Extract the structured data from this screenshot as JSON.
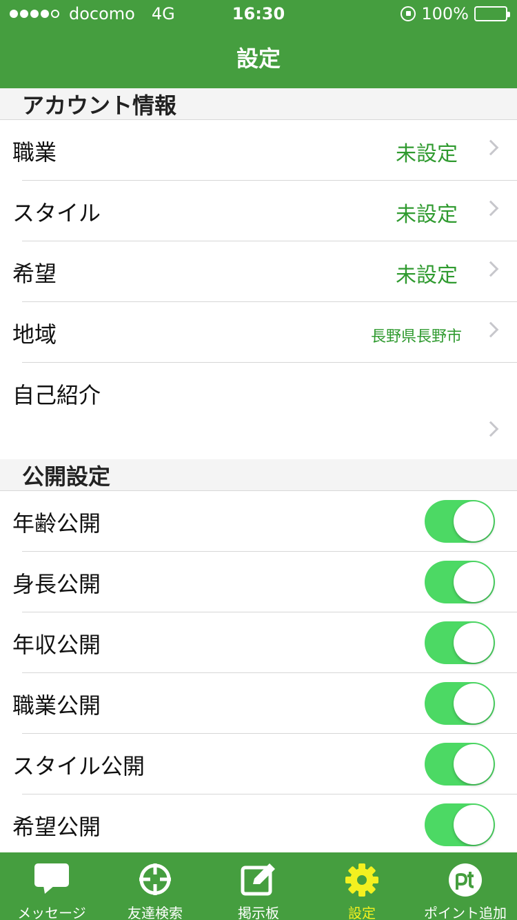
{
  "status_bar": {
    "carrier": "docomo",
    "network": "4G",
    "time": "16:30",
    "battery": "100%"
  },
  "nav": {
    "title": "設定"
  },
  "sections": {
    "account": {
      "title": "アカウント情報",
      "rows": [
        {
          "label": "職業",
          "value": "未設定"
        },
        {
          "label": "スタイル",
          "value": "未設定"
        },
        {
          "label": "希望",
          "value": "未設定"
        },
        {
          "label": "地域",
          "value": "長野県長野市"
        },
        {
          "label": "自己紹介",
          "value": ""
        }
      ]
    },
    "visibility": {
      "title": "公開設定",
      "rows": [
        {
          "label": "年齢公開",
          "on": true
        },
        {
          "label": "身長公開",
          "on": true
        },
        {
          "label": "年収公開",
          "on": true
        },
        {
          "label": "職業公開",
          "on": true
        },
        {
          "label": "スタイル公開",
          "on": true
        },
        {
          "label": "希望公開",
          "on": true
        }
      ]
    }
  },
  "tabbar": {
    "tabs": [
      {
        "label": "メッセージ",
        "icon": "message-icon"
      },
      {
        "label": "友達検索",
        "icon": "crosshair-icon"
      },
      {
        "label": "掲示板",
        "icon": "edit-icon"
      },
      {
        "label": "設定",
        "icon": "gear-icon",
        "active": true
      },
      {
        "label": "ポイント追加",
        "icon": "points-icon"
      }
    ]
  },
  "colors": {
    "brand_green": "#459e3f",
    "value_green": "#2f9a2f",
    "toggle_on": "#4cd964",
    "active_tab": "#f3f020"
  }
}
